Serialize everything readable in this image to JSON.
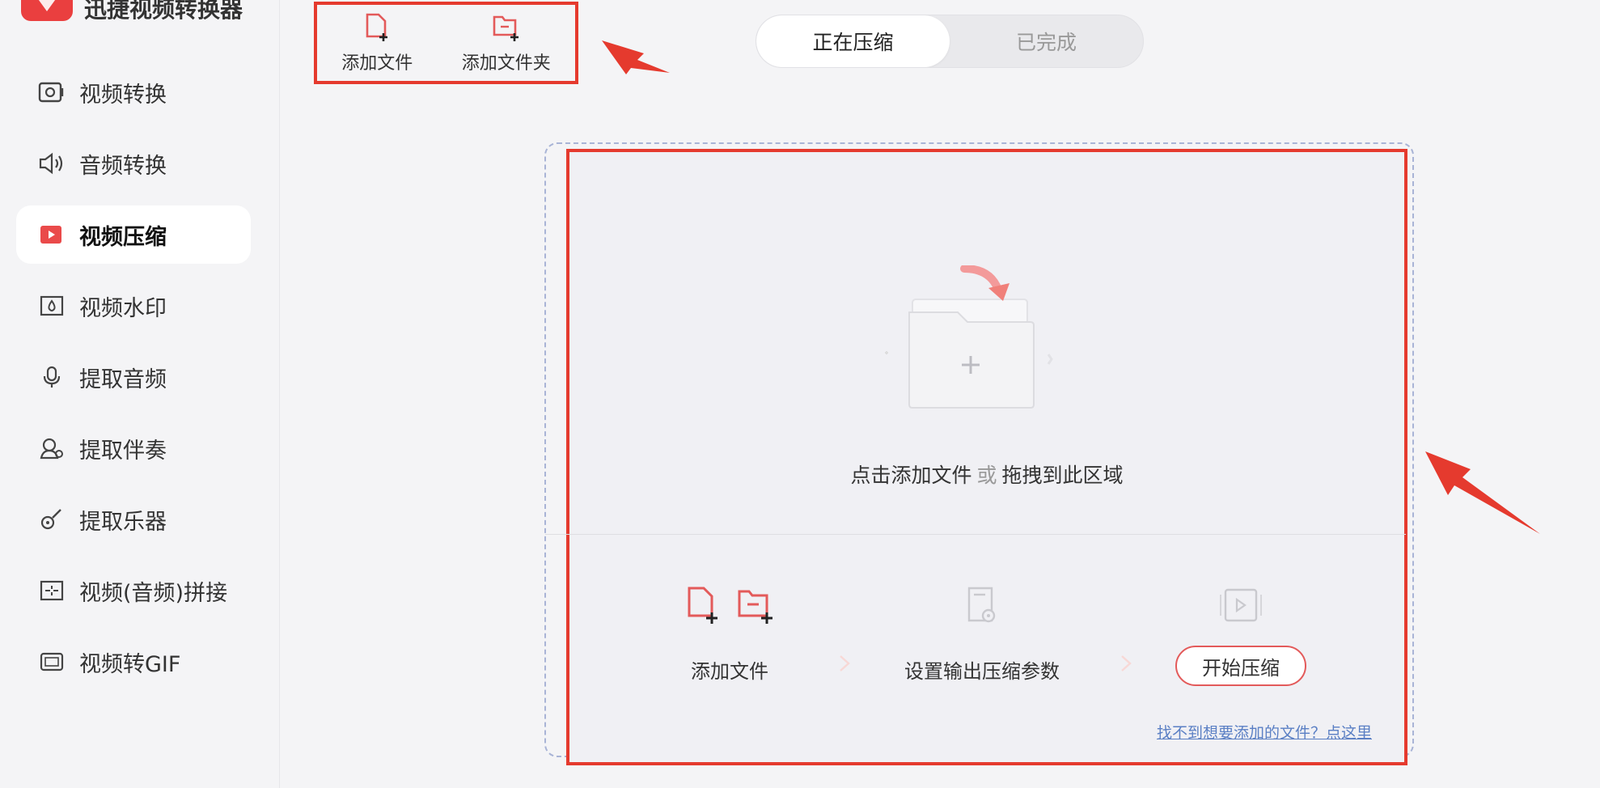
{
  "app": {
    "title": "迅捷视频转换器"
  },
  "sidebar": {
    "items": [
      {
        "label": "视频转换",
        "icon": "video-convert-icon"
      },
      {
        "label": "音频转换",
        "icon": "audio-convert-icon"
      },
      {
        "label": "视频压缩",
        "icon": "video-compress-icon",
        "active": true
      },
      {
        "label": "视频水印",
        "icon": "watermark-icon"
      },
      {
        "label": "提取音频",
        "icon": "extract-audio-icon"
      },
      {
        "label": "提取伴奏",
        "icon": "extract-accompaniment-icon"
      },
      {
        "label": "提取乐器",
        "icon": "guitar-icon"
      },
      {
        "label": "视频(音频)拼接",
        "icon": "merge-icon"
      },
      {
        "label": "视频转GIF",
        "icon": "gif-icon"
      }
    ]
  },
  "toolbar": {
    "add_file": "添加文件",
    "add_folder": "添加文件夹"
  },
  "tabs": [
    {
      "label": "正在压缩",
      "active": true
    },
    {
      "label": "已完成",
      "active": false
    }
  ],
  "dropzone": {
    "hint_main": "点击添加文件",
    "hint_or": "或",
    "hint_drag": "拖拽到此区域"
  },
  "steps": {
    "step1": "添加文件",
    "step2": "设置输出压缩参数",
    "step3_button": "开始压缩"
  },
  "help_link": "找不到想要添加的文件？点这里",
  "colors": {
    "accent_red": "#e53a2e",
    "icon_red": "#e35a5a",
    "link_blue": "#5a7fc4",
    "dashed_blue": "#a9b4d6"
  }
}
